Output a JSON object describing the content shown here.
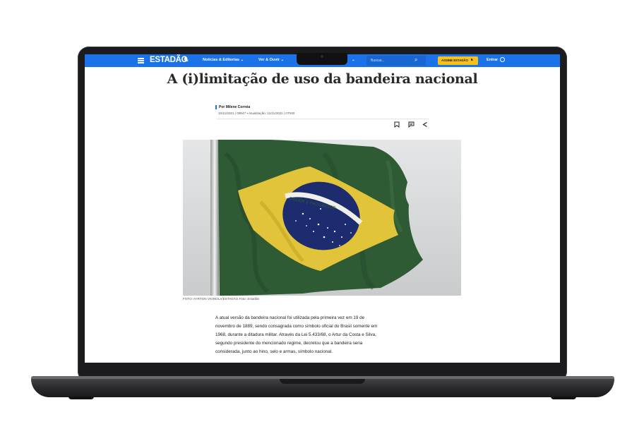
{
  "nav": {
    "logo": "ESTADÃO",
    "items": [
      "Notícias & Editorias ⌄",
      "Ver & Ouvir ⌄",
      "⌄"
    ],
    "search_placeholder": "Buscar...",
    "subscribe_label": "ASSINE ESTADÃO",
    "login_label": "Entrar"
  },
  "article": {
    "title": "A (i)limitação de uso da bandeira nacional",
    "author": "Por Milene Correia",
    "dates": "10/11/2021 | 09h47  •  Atualização: 11/11/2021 | 07h00",
    "photo_caption_credit": "FOTO: AYRTON VIGNOLA/ESTADÃO",
    "photo_caption_source": "Foto: Estadão",
    "flag_motto": "ORDEM E PROGRESSO",
    "body_lines": [
      "A atual versão da bandeira nacional foi utilizada pela primeira vez em 19 de",
      "novembro de 1889, sendo consagrada como símbolo oficial do Brasil somente em",
      "1968, durante a ditadura militar. Através da Lei 5.433/68, o Artur da Costa e Silva,",
      "segundo presidente do mencionado regime, decretou que a bandeira seria",
      "considerada, junto ao hino, selo e armas, símbolo nacional."
    ]
  },
  "colors": {
    "nav_blue": "#1a73e8",
    "subscribe_yellow": "#f6c21a",
    "flag_green": "#2e5a34",
    "flag_yellow": "#e2c43a",
    "flag_blue": "#1c2c6e"
  },
  "icons": [
    "menu-icon",
    "horse-logo-icon",
    "search-icon",
    "user-icon",
    "bookmark-icon",
    "comment-icon",
    "share-icon"
  ]
}
